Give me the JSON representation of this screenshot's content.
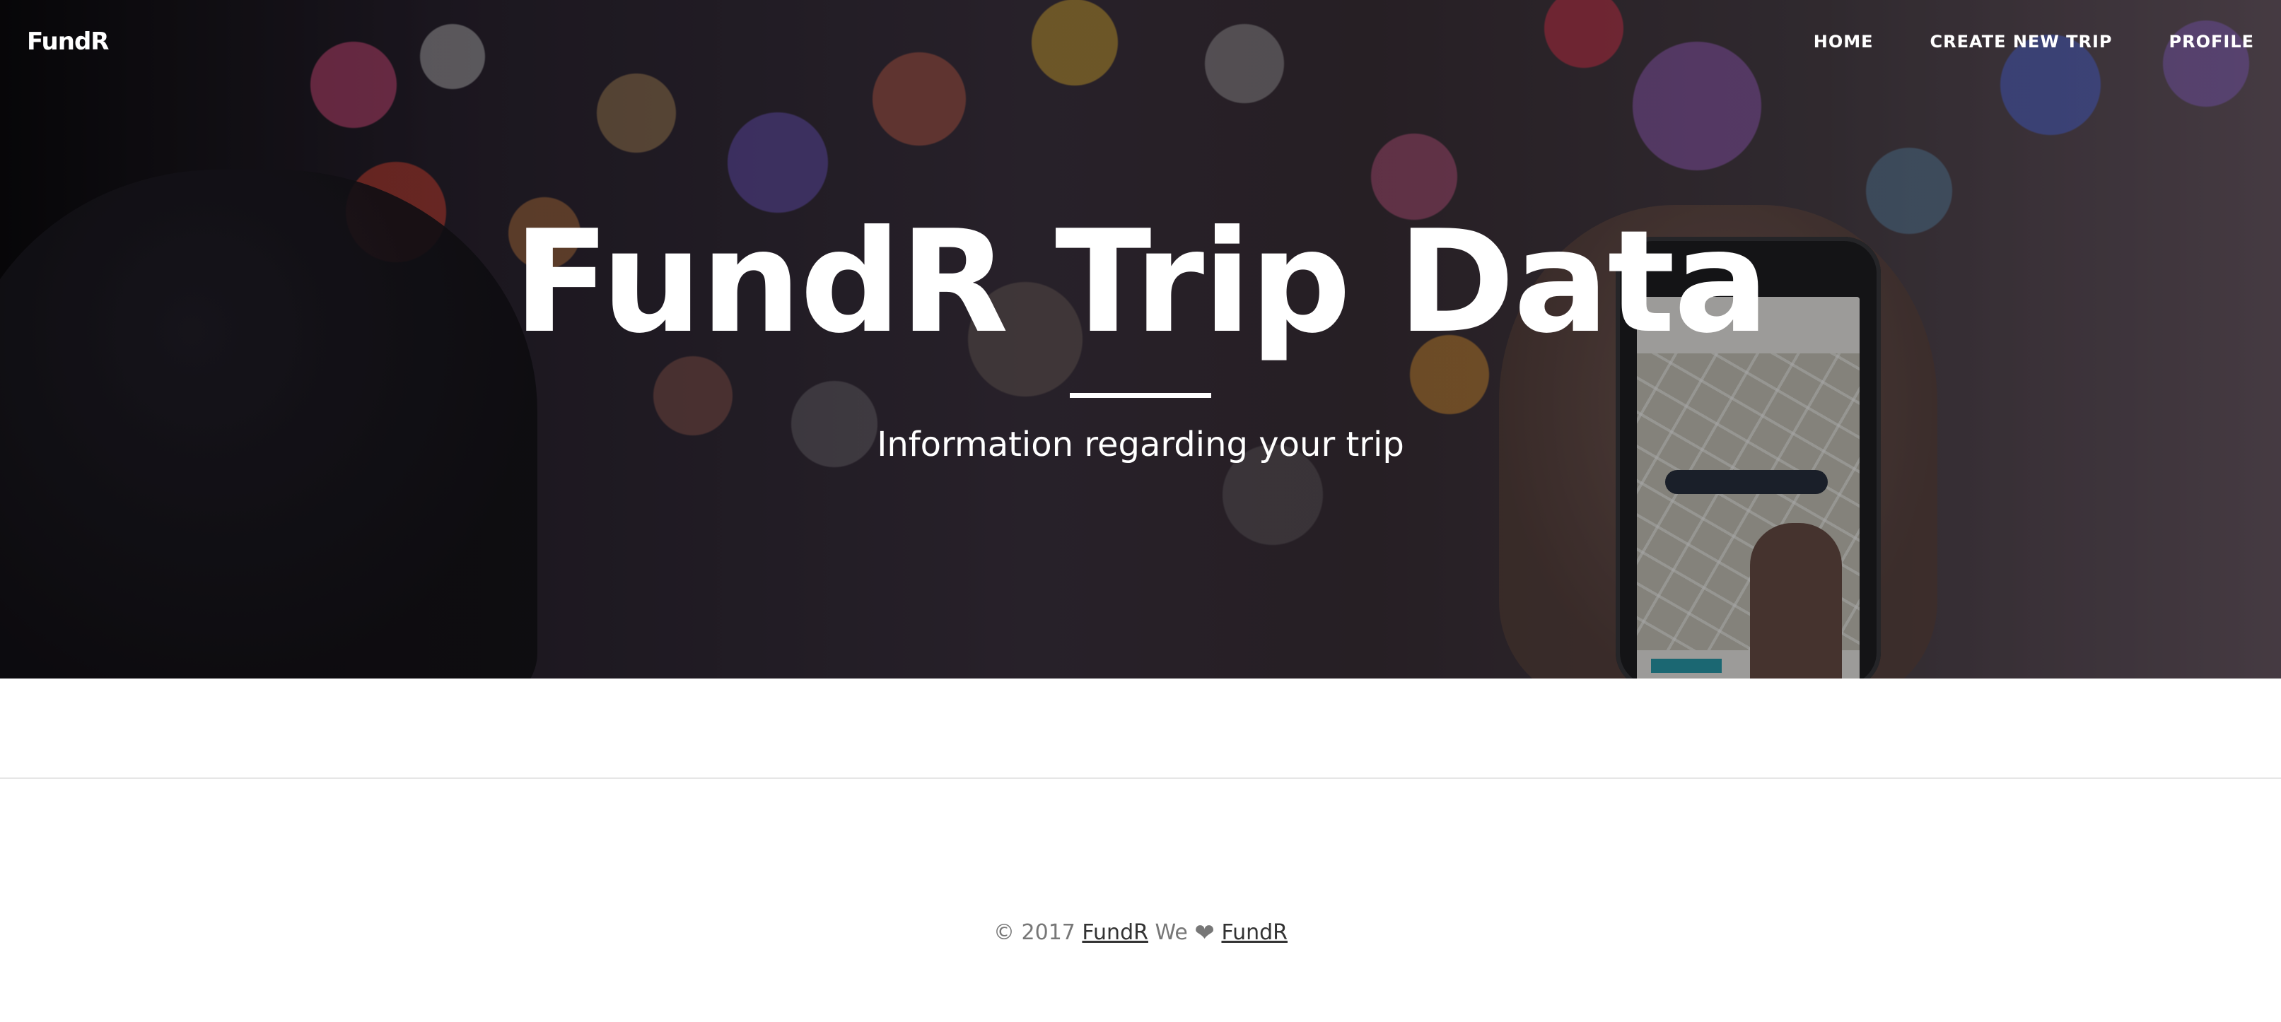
{
  "brand": "FundR",
  "nav": {
    "items": [
      {
        "label": "HOME"
      },
      {
        "label": "CREATE NEW TRIP"
      },
      {
        "label": "PROFILE"
      }
    ]
  },
  "hero": {
    "title": "FundR Trip Data",
    "subtitle": "Information regarding your trip"
  },
  "footer": {
    "copyright": "© 2017",
    "link1": "FundR",
    "we": "We",
    "heart_icon": "heart-icon",
    "link2": "FundR"
  },
  "colors": {
    "hero_text": "#ffffff",
    "footer_text": "#777777",
    "footer_link": "#333333",
    "separator": "#e6e6e6"
  }
}
